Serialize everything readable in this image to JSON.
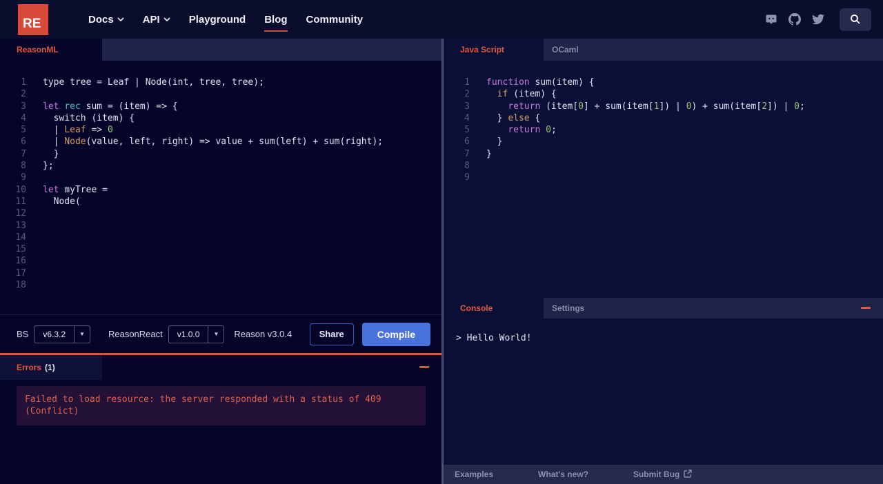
{
  "colors": {
    "accent_red": "#e4573d",
    "logo_red": "#d8493a",
    "compile_blue": "#4a72dc",
    "left_editor_bg": "#05052a",
    "right_editor_bg": "#0a1035",
    "tabstrip_bg": "#1e2348",
    "error_box_bg": "#231137",
    "keyword": "#c678dd",
    "atom_orange": "#d19a66",
    "number_green": "#98c379",
    "cyan": "#56b6c2"
  },
  "header": {
    "logo_text": "RE",
    "nav_items": [
      {
        "label": "Docs",
        "has_dropdown": true,
        "active": false
      },
      {
        "label": "API",
        "has_dropdown": true,
        "active": false
      },
      {
        "label": "Playground",
        "has_dropdown": false,
        "active": false
      },
      {
        "label": "Blog",
        "has_dropdown": false,
        "active": true
      },
      {
        "label": "Community",
        "has_dropdown": false,
        "active": false
      }
    ],
    "social_icons": [
      "discord",
      "github",
      "twitter"
    ],
    "search_icon": "magnifier"
  },
  "left_editor": {
    "tab_label": "ReasonML",
    "line_count": 18,
    "lines": [
      [
        [
          "p",
          "type tree = Leaf | Node(int, tree, tree);"
        ]
      ],
      [],
      [
        [
          "k",
          "let"
        ],
        [
          "p",
          " "
        ],
        [
          "c",
          "rec"
        ],
        [
          "p",
          " sum = (item) => {"
        ]
      ],
      [
        [
          "p",
          "  switch (item) {"
        ]
      ],
      [
        [
          "p",
          "  | "
        ],
        [
          "a",
          "Leaf"
        ],
        [
          "p",
          " => "
        ],
        [
          "n",
          "0"
        ]
      ],
      [
        [
          "p",
          "  | "
        ],
        [
          "a",
          "Node"
        ],
        [
          "p",
          "(value, left, right) => value + sum(left) + sum(right);"
        ]
      ],
      [
        [
          "p",
          "  }"
        ]
      ],
      [
        [
          "p",
          "};"
        ]
      ],
      [],
      [
        [
          "k",
          "let"
        ],
        [
          "p",
          " myTree ="
        ]
      ],
      [
        [
          "p",
          "  Node("
        ]
      ],
      [],
      [],
      [],
      [],
      [],
      [],
      []
    ]
  },
  "right_editor": {
    "active_tab_label": "Java Script",
    "inactive_tab_label": "OCaml",
    "line_count": 9,
    "lines": [
      [
        [
          "k",
          "function"
        ],
        [
          "p",
          " sum(item) {"
        ]
      ],
      [
        [
          "p",
          "  "
        ],
        [
          "a",
          "if"
        ],
        [
          "p",
          " (item) {"
        ]
      ],
      [
        [
          "p",
          "    "
        ],
        [
          "k",
          "return"
        ],
        [
          "p",
          " (item["
        ],
        [
          "n",
          "0"
        ],
        [
          "p",
          "] + sum(item["
        ],
        [
          "n",
          "1"
        ],
        [
          "p",
          "]) | "
        ],
        [
          "n",
          "0"
        ],
        [
          "p",
          ") + sum(item["
        ],
        [
          "n",
          "2"
        ],
        [
          "p",
          "]) | "
        ],
        [
          "n",
          "0"
        ],
        [
          "p",
          ";"
        ]
      ],
      [
        [
          "p",
          "  } "
        ],
        [
          "a",
          "else"
        ],
        [
          "p",
          " {"
        ]
      ],
      [
        [
          "p",
          "    "
        ],
        [
          "k",
          "return"
        ],
        [
          "p",
          " "
        ],
        [
          "n",
          "0"
        ],
        [
          "p",
          ";"
        ]
      ],
      [
        [
          "p",
          "  }"
        ]
      ],
      [
        [
          "p",
          "}"
        ]
      ],
      [],
      []
    ]
  },
  "toolbar": {
    "bs_label": "BS",
    "bs_version": "v6.3.2",
    "reason_react_label": "ReasonReact",
    "reason_react_version": "v1.0.0",
    "reason_version_text": "Reason v3.0.4",
    "share_label": "Share",
    "compile_label": "Compile"
  },
  "errors": {
    "tab_label": "Errors",
    "count_label": "(1)",
    "message_line1": "Failed to load resource: the server responded with a status of 409",
    "message_line2": "(Conflict)"
  },
  "console": {
    "tab_label": "Console",
    "settings_tab_label": "Settings",
    "output_text": "> Hello World!"
  },
  "footer": {
    "examples_label": "Examples",
    "whats_new_label": "What's new?",
    "submit_bug_label": "Submit Bug"
  }
}
